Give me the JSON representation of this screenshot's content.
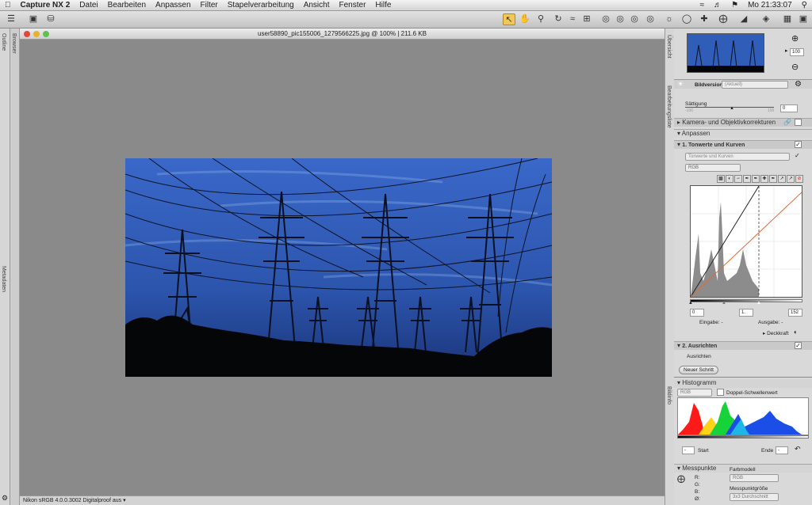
{
  "menubar": {
    "app_name": "Capture NX 2",
    "items": [
      "Datei",
      "Bearbeiten",
      "Anpassen",
      "Filter",
      "Stapelverarbeitung",
      "Ansicht",
      "Fenster",
      "Hilfe"
    ],
    "clock": "Mo 21:33:07"
  },
  "left_strip": {
    "outline": "Outline",
    "browser": "Browser",
    "metadata": "Metadaten"
  },
  "document": {
    "title": "user58890_pic155006_1279566225.jpg @ 100% | 211.6 KB",
    "status": "Nikon sRGB 4.0.0.3002  Digitalproof aus"
  },
  "right_strip": {
    "overview": "Übersicht",
    "edit_list": "Bearbeitungsliste",
    "photo_info": "Bildinfo"
  },
  "overview": {
    "zoom_value": "100"
  },
  "edit": {
    "bildversion_label": "Bildversion",
    "bildversion_value": "(Aktuell)",
    "saettigung_label": "Sättigung",
    "saettigung_min": "-100",
    "saettigung_max": "100",
    "saettigung_value": "0",
    "kamera_label": "Kamera- und Objektivkorrekturen",
    "anpassen_label": "Anpassen",
    "step1_label": "1. Tonwerte und Kurven",
    "step1_dropdown": "Tonwerte und Kurven",
    "channel": "RGB",
    "black_point": "0",
    "gamma": "1.",
    "white_point": "152",
    "eingabe": "Eingabe: -",
    "ausgabe": "Ausgabe: -",
    "deckkraft": "Deckkraft",
    "step2_label": "2. Ausrichten",
    "ausrichten": "Ausrichten",
    "new_step_button": "Neuer Schritt"
  },
  "histogram": {
    "title": "Histogramm",
    "channel": "RGB",
    "double_threshold": "Doppel-Schwellenwert",
    "start_label": "Start",
    "start_value": "-",
    "end_label": "Ende",
    "end_value": "-"
  },
  "messpunkte": {
    "title": "Messpunkte",
    "r": "R:",
    "g": "G:",
    "b": "B:",
    "o": "Ø:",
    "farbmodell_label": "Farbmodell",
    "farbmodell_value": "RGB",
    "size_label": "Messpunktgröße",
    "size_value": "3x3 Durchschnitt"
  },
  "colors": {
    "sky": "#2d5bb5",
    "curve": "#e06a3a",
    "accent": "#f0c85a"
  }
}
